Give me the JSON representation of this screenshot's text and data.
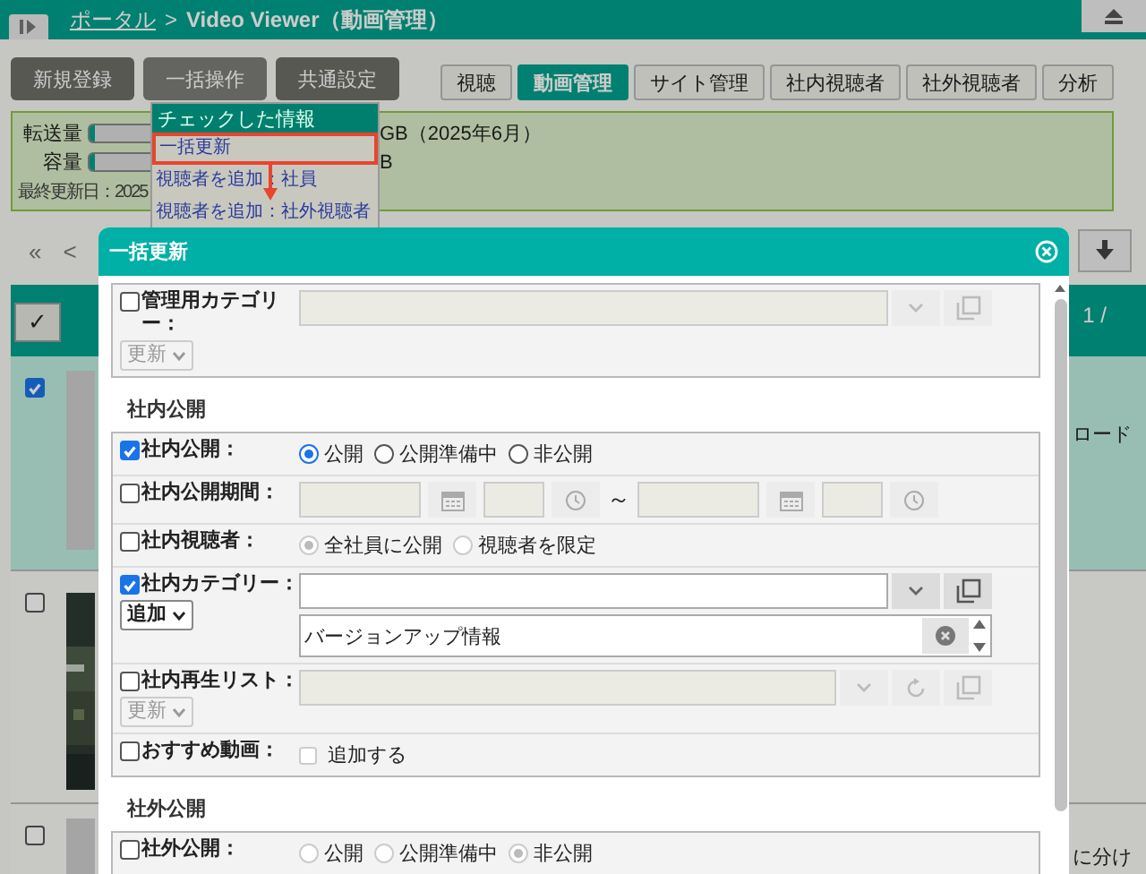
{
  "header": {
    "link": "ポータル",
    "separator": ">",
    "title": "Video Viewer（動画管理）"
  },
  "toolbar_buttons": [
    {
      "label": "新規登録",
      "selected": false
    },
    {
      "label": "一括操作",
      "selected": true
    },
    {
      "label": "共通設定",
      "selected": false
    }
  ],
  "nav_tabs": [
    {
      "label": "視聴",
      "selected": false
    },
    {
      "label": "動画管理",
      "selected": true
    },
    {
      "label": "サイト管理",
      "selected": false
    },
    {
      "label": "社内視聴者",
      "selected": false
    },
    {
      "label": "社外視聴者",
      "selected": false
    },
    {
      "label": "分析",
      "selected": false
    }
  ],
  "usage": {
    "rows": [
      {
        "label": "転送量",
        "level": 0.02,
        "reading": "GB（2025年6月）"
      },
      {
        "label": "容量",
        "level": 0.02,
        "reading": "B"
      }
    ],
    "updated": "最終更新日：2025"
  },
  "list_toolbar": {
    "first": "«",
    "prev": "<"
  },
  "table": {
    "check_all": "✓",
    "header_text": "1 /",
    "rows": [
      {
        "checked": true,
        "selected": true,
        "text": "ロード"
      },
      {
        "checked": false,
        "selected": false,
        "kind": "picture"
      },
      {
        "checked": false,
        "selected": false,
        "text": "に分け"
      }
    ]
  },
  "bulk_menu": {
    "header": "チェックした情報",
    "items": [
      {
        "label": "一括更新",
        "highlighted": true
      },
      {
        "label": "視聴者を追加：社員",
        "highlighted": false
      },
      {
        "label": "視聴者を追加：社外視聴者",
        "highlighted": false
      }
    ]
  },
  "modal": {
    "title": "一括更新",
    "sections": [
      {
        "rows": [
          {
            "kind": "select_field",
            "label": "管理用カテゴリー：",
            "checked": false,
            "mode": "更新",
            "tools": [
              {
                "kind": "dropdown"
              },
              {
                "kind": "copy"
              }
            ]
          }
        ]
      },
      {
        "heading": "社内公開",
        "rows": [
          {
            "kind": "radios",
            "label": "社内公開：",
            "checked": true,
            "options": [
              {
                "label": "公開",
                "selected": true
              },
              {
                "label": "公開準備中",
                "selected": false
              },
              {
                "label": "非公開",
                "selected": false
              }
            ]
          },
          {
            "kind": "period",
            "label": "社内公開期間：",
            "checked": false,
            "separator": "～"
          },
          {
            "kind": "radios",
            "label": "社内視聴者：",
            "checked": false,
            "options": [
              {
                "label": "全社員に公開",
                "selected": true
              },
              {
                "label": "視聴者を限定",
                "selected": false
              }
            ]
          },
          {
            "kind": "select_field",
            "label": "社内カテゴリー：",
            "checked": true,
            "mode": "追加",
            "tools": [
              {
                "kind": "dropdown"
              },
              {
                "kind": "copy"
              }
            ],
            "values": [
              "バージョンアップ情報"
            ]
          },
          {
            "kind": "select_field",
            "label": "社内再生リスト：",
            "checked": false,
            "mode": "更新",
            "tools": [
              {
                "kind": "dropdown"
              },
              {
                "kind": "refresh"
              },
              {
                "kind": "copy"
              }
            ]
          },
          {
            "kind": "option",
            "label": "おすすめ動画：",
            "checked": false,
            "option": {
              "label": "追加する",
              "checked": false
            }
          }
        ]
      },
      {
        "heading": "社外公開",
        "rows": [
          {
            "kind": "radios",
            "label": "社外公開：",
            "checked": false,
            "options": [
              {
                "label": "公開",
                "selected": false
              },
              {
                "label": "公開準備中",
                "selected": false
              },
              {
                "label": "非公開",
                "selected": true
              }
            ]
          }
        ]
      }
    ]
  }
}
